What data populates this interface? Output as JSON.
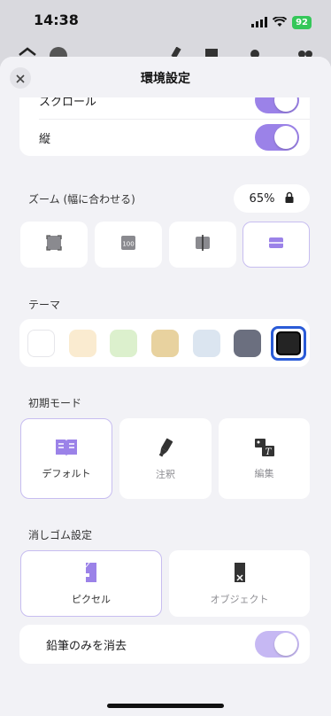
{
  "status": {
    "time": "14:38",
    "battery": "92"
  },
  "header": {
    "title": "環境設定"
  },
  "scroll": {
    "partial_label": "スクロール",
    "vertical_label": "縦"
  },
  "zoom": {
    "label": "ズーム (幅に合わせる)",
    "value": "65%"
  },
  "theme": {
    "label": "テーマ",
    "swatches": [
      "#ffffff",
      "#faebd0",
      "#dcf0cd",
      "#e8d29f",
      "#dbe5f0",
      "#6b6f7f",
      "#242424"
    ],
    "selected_index": 6,
    "accent": "#2a5bd7"
  },
  "initial_mode": {
    "label": "初期モード",
    "options": [
      "デフォルト",
      "注釈",
      "編集"
    ]
  },
  "eraser": {
    "label": "消しゴム設定",
    "options": [
      "ピクセル",
      "オブジェクト"
    ],
    "pencil_only_label": "鉛筆のみを消去"
  },
  "colors": {
    "accent_purple": "#9b82e8"
  }
}
